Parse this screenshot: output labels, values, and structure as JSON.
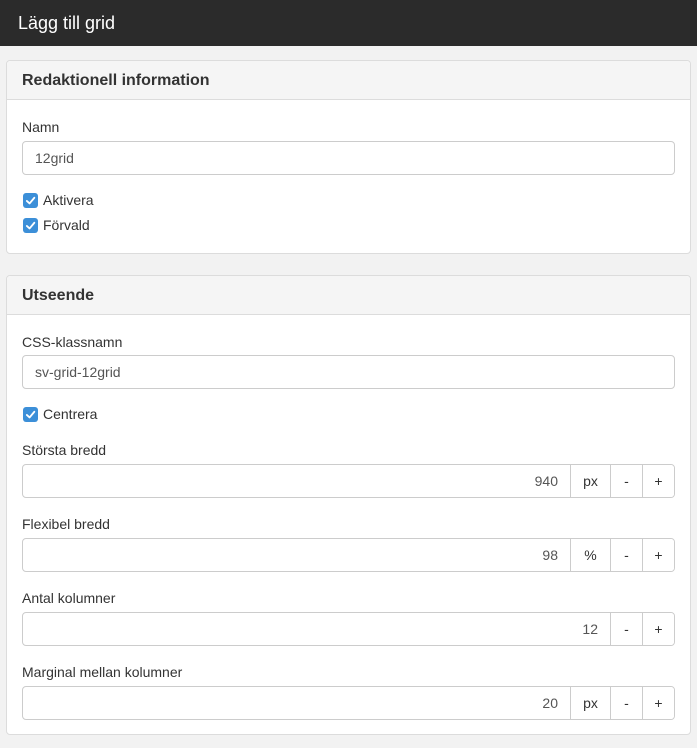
{
  "window": {
    "title": "Lägg till grid"
  },
  "editorial": {
    "heading": "Redaktionell information",
    "name_label": "Namn",
    "name_value": "12grid",
    "activate_label": "Aktivera",
    "default_label": "Förvald"
  },
  "appearance": {
    "heading": "Utseende",
    "css_label": "CSS-klassnamn",
    "css_value": "sv-grid-12grid",
    "center_label": "Centrera",
    "max_width": {
      "label": "Största bredd",
      "value": "940",
      "unit": "px"
    },
    "flex_width": {
      "label": "Flexibel bredd",
      "value": "98",
      "unit": "%"
    },
    "columns": {
      "label": "Antal kolumner",
      "value": "12"
    },
    "gutter": {
      "label": "Marginal mellan kolumner",
      "value": "20",
      "unit": "px"
    },
    "minus": "-",
    "plus": "+"
  },
  "colors": {
    "accent": "#3c8fd8",
    "titlebar": "#2b2b2b"
  },
  "icons": [
    "check-icon"
  ]
}
